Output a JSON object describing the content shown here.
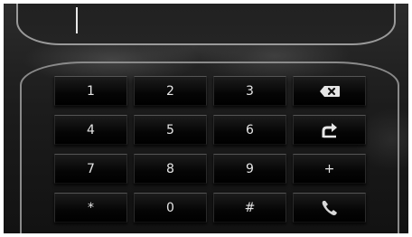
{
  "display": {
    "number": ""
  },
  "keypad": {
    "keys": [
      {
        "label": "1"
      },
      {
        "label": "2"
      },
      {
        "label": "3"
      },
      {
        "icon": "backspace-icon"
      },
      {
        "label": "4"
      },
      {
        "label": "5"
      },
      {
        "label": "6"
      },
      {
        "icon": "redial-icon"
      },
      {
        "label": "7"
      },
      {
        "label": "8"
      },
      {
        "label": "9"
      },
      {
        "label": "+"
      },
      {
        "label": "*"
      },
      {
        "label": "0"
      },
      {
        "label": "#"
      },
      {
        "icon": "call-icon"
      }
    ]
  }
}
